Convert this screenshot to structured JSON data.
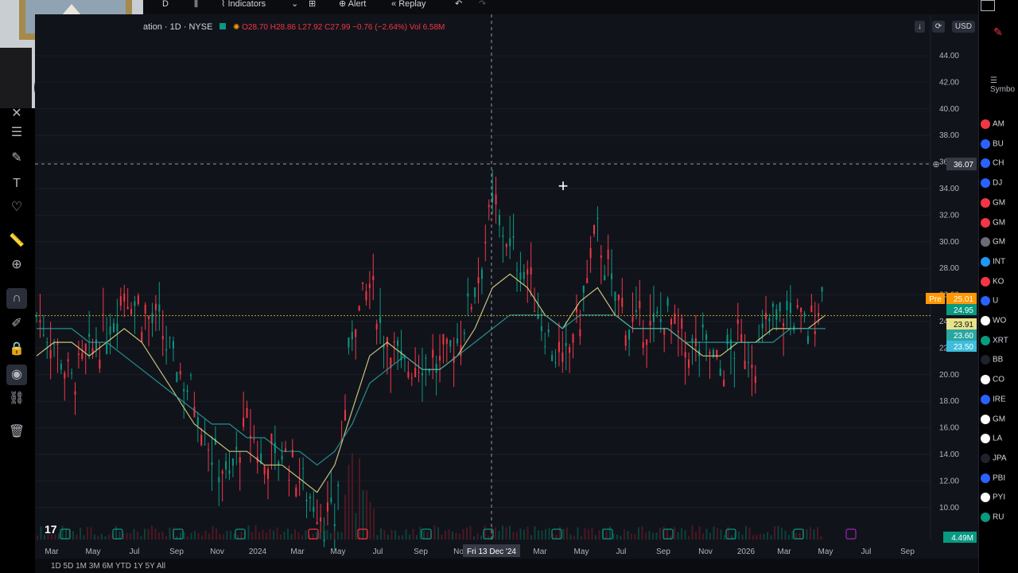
{
  "toolbar": {
    "interval": "D",
    "indicators_label": "Indicators",
    "alert_label": "Alert",
    "replay_label": "Replay"
  },
  "legend": {
    "symbol": "ation · 1D · NYSE",
    "open": "O28.70",
    "high": "H28.86",
    "low": "L27.92",
    "close": "C27.99",
    "change": "−0.76 (−2.64%)",
    "volume": "Vol 6.58M"
  },
  "chart_controls": {
    "currency": "USD"
  },
  "crosshair": {
    "price_label": "36.07",
    "date_label": "Fri 13 Dec '24"
  },
  "price_tags": [
    {
      "text": "Pre",
      "value": "25.01",
      "color": "#ff9800"
    },
    {
      "text": "",
      "value": "24.95",
      "color": "#089981"
    },
    {
      "text": "",
      "value": "23.91",
      "color": "#e6e38c"
    },
    {
      "text": "",
      "value": "23.60",
      "color": "#2aa6a1"
    },
    {
      "text": "",
      "value": "23.50",
      "color": "#3dbddb"
    }
  ],
  "volume_tag": "4.49M",
  "chart_data": {
    "type": "line",
    "ylim": [
      9,
      45
    ],
    "yticks": [
      "44.00",
      "42.00",
      "40.00",
      "38.00",
      "36.00",
      "34.00",
      "32.00",
      "30.00",
      "28.00",
      "26.00",
      "24.00",
      "22.00",
      "20.00",
      "18.00",
      "16.00",
      "14.00",
      "12.00",
      "10.00"
    ],
    "xticks": [
      "Mar",
      "May",
      "Jul",
      "Sep",
      "Nov",
      "2024",
      "Mar",
      "May",
      "Jul",
      "Sep",
      "Nov",
      "Mar",
      "May",
      "Jul",
      "Sep",
      "Nov",
      "2026",
      "Mar",
      "May",
      "Jul",
      "Sep"
    ],
    "x": [
      0,
      1,
      2,
      3,
      4,
      5,
      6,
      7,
      8,
      9,
      10,
      11,
      12,
      13,
      14,
      15,
      16,
      17,
      18,
      19,
      20,
      21,
      22,
      23,
      24,
      25,
      26,
      27,
      28,
      29,
      30,
      31,
      32,
      33,
      34,
      35,
      36,
      37,
      38,
      39,
      40
    ],
    "series": [
      {
        "values": [
          25,
          23,
          20,
          22,
          24,
          27,
          25,
          24,
          21,
          19,
          15,
          13,
          17,
          14,
          15,
          13,
          11,
          10,
          24,
          27,
          23,
          21,
          22,
          21,
          23,
          27,
          33,
          30,
          28,
          24,
          21,
          25,
          31,
          26,
          24,
          24,
          25,
          22,
          23,
          21,
          23,
          22,
          25,
          25,
          24,
          27
        ]
      },
      {
        "values": [
          22,
          23,
          23,
          22,
          23,
          24,
          23,
          21,
          19,
          17,
          16,
          15,
          15,
          14,
          14,
          13,
          12,
          14,
          18,
          22,
          23,
          22,
          21,
          21,
          22,
          24,
          27,
          28,
          27,
          25,
          24,
          26,
          27,
          25,
          24,
          24,
          24,
          23,
          22,
          22,
          23,
          23,
          24,
          24,
          24,
          25
        ]
      },
      {
        "values": [
          24,
          24,
          24,
          23,
          23,
          22,
          21,
          20,
          19,
          18,
          17,
          17,
          16,
          16,
          15,
          15,
          14,
          15,
          17,
          20,
          21,
          22,
          21,
          21,
          22,
          23,
          24,
          25,
          25,
          25,
          24,
          25,
          25,
          25,
          24,
          24,
          24,
          23,
          23,
          23,
          23,
          23,
          23,
          24,
          24,
          24
        ]
      }
    ]
  },
  "watchlist": {
    "items": [
      {
        "sym": "AM",
        "color": "#f23645"
      },
      {
        "sym": "BU",
        "color": "#2962ff"
      },
      {
        "sym": "CH",
        "color": "#2962ff"
      },
      {
        "sym": "DJ",
        "color": "#2962ff"
      },
      {
        "sym": "GM",
        "color": "#f23645"
      },
      {
        "sym": "GM",
        "color": "#f23645"
      },
      {
        "sym": "GM",
        "color": "#6a6d78"
      },
      {
        "sym": "INT",
        "color": "#2196f3"
      },
      {
        "sym": "KO",
        "color": "#f23645"
      },
      {
        "sym": "U",
        "color": "#2962ff"
      },
      {
        "sym": "WO",
        "color": "#ffffff"
      },
      {
        "sym": "XRT",
        "color": "#089981"
      },
      {
        "sym": "BB",
        "color": "#1e222d"
      },
      {
        "sym": "CO",
        "color": "#ffffff"
      },
      {
        "sym": "IRE",
        "color": "#2962ff"
      },
      {
        "sym": "GM",
        "color": "#ffffff"
      },
      {
        "sym": "LA",
        "color": "#ffffff"
      },
      {
        "sym": "JPA",
        "color": "#1e222d"
      },
      {
        "sym": "PBI",
        "color": "#2962ff"
      },
      {
        "sym": "PYI",
        "color": "#ffffff"
      },
      {
        "sym": "RU",
        "color": "#089981"
      }
    ]
  }
}
